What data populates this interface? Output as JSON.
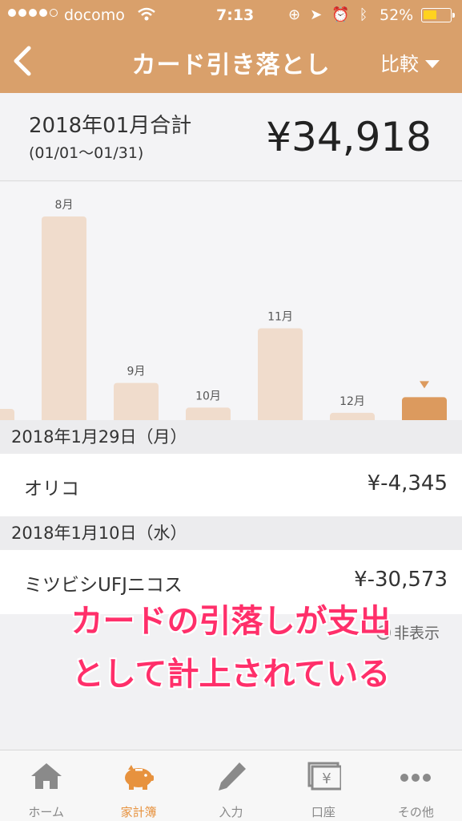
{
  "status_bar": {
    "carrier": "docomo",
    "time": "7:13",
    "battery_percent": "52%",
    "battery_level": 0.52
  },
  "nav": {
    "title": "カード引き落とし",
    "compare_label": "比較"
  },
  "summary": {
    "label": "2018年01月合計",
    "range": "(01/01〜01/31)",
    "amount": "¥34,918"
  },
  "chart_data": {
    "type": "bar",
    "categories": [
      "",
      "8月",
      "9月",
      "10月",
      "11月",
      "12月",
      ""
    ],
    "values": [
      4000,
      78000,
      14000,
      4500,
      35000,
      2500,
      8500
    ],
    "highlight_index": 6,
    "colors": {
      "bar": "#f0dccc",
      "highlight": "#dc9a5e"
    }
  },
  "entries": [
    {
      "date": "2018年1月29日（月）",
      "name": "オリコ",
      "amount": "¥-4,345"
    },
    {
      "date": "2018年1月10日（水）",
      "name": "ミツビシUFJニコス",
      "amount": "¥-30,573"
    }
  ],
  "hide_toggle_label": "非表示",
  "overlay": {
    "line1": "カードの引落しが支出",
    "line2": "として計上されている"
  },
  "tabs": [
    {
      "label": "ホーム",
      "icon": "home-icon"
    },
    {
      "label": "家計簿",
      "icon": "piggy-bank-icon",
      "active": true
    },
    {
      "label": "入力",
      "icon": "pencil-icon"
    },
    {
      "label": "口座",
      "icon": "bank-card-icon"
    },
    {
      "label": "その他",
      "icon": "more-icon"
    }
  ],
  "colors": {
    "header": "#d9a06b",
    "accent": "#e7923e",
    "overlay_text": "#ff2f6a"
  }
}
